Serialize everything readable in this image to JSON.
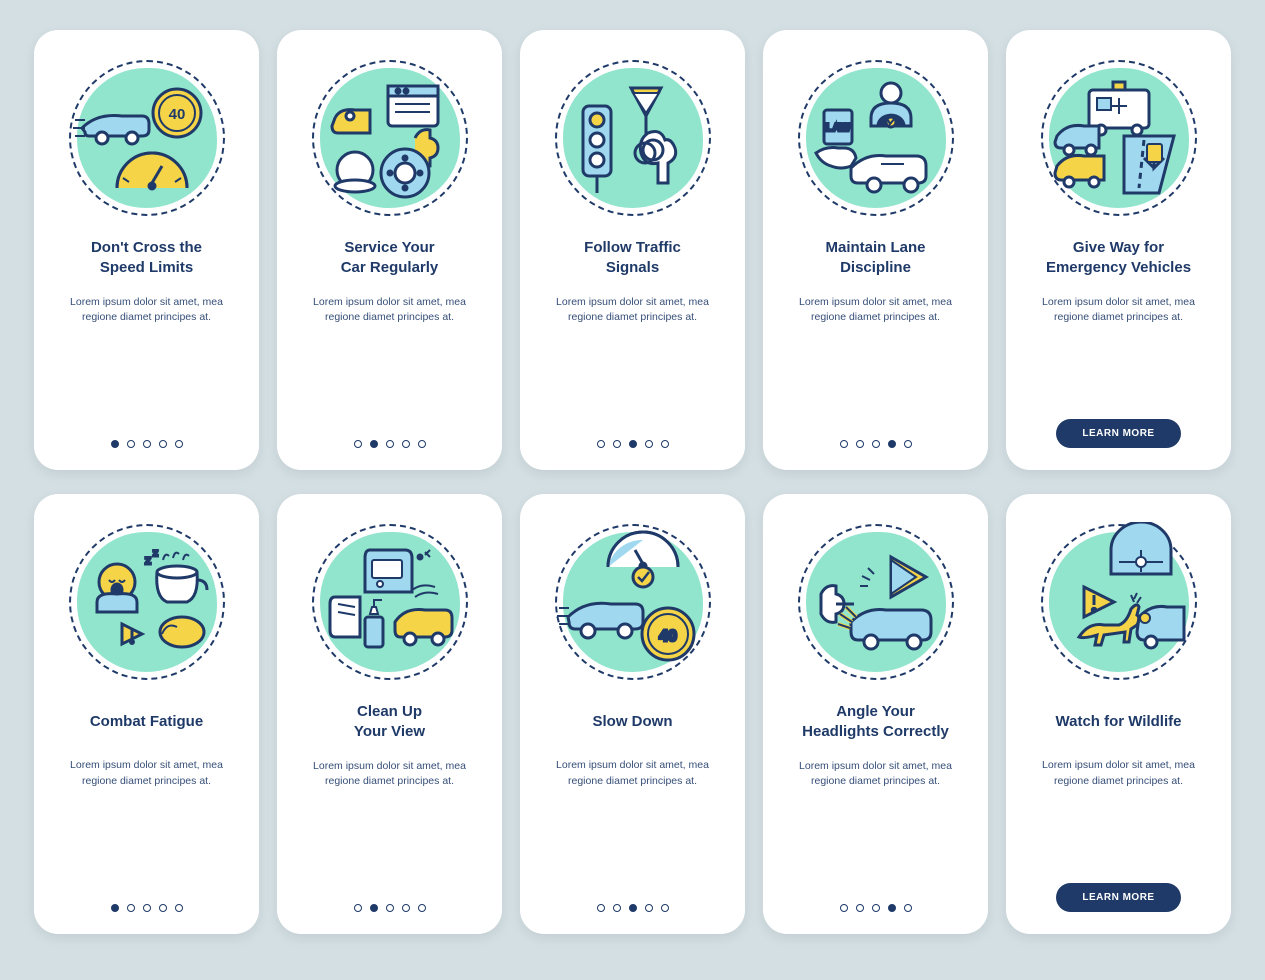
{
  "colors": {
    "navy": "#1f3a68",
    "mint": "#7fe0c4",
    "yellow": "#f5d547",
    "lightblue": "#a0d8ef",
    "bg": "#d3dfe3"
  },
  "lorem": "Lorem ipsum dolor sit amet, mea regione diamet principes at.",
  "learn_more": "LEARN MORE",
  "cards": [
    {
      "id": "speed-limits",
      "title": "Don't Cross the\nSpeed Limits",
      "icon": "speed-limit-icon",
      "active_dot": 0,
      "has_button": false
    },
    {
      "id": "service-car",
      "title": "Service Your\nCar Regularly",
      "icon": "service-car-icon",
      "active_dot": 1,
      "has_button": false
    },
    {
      "id": "traffic-signals",
      "title": "Follow Traffic\nSignals",
      "icon": "traffic-signal-icon",
      "active_dot": 2,
      "has_button": false
    },
    {
      "id": "lane-discipline",
      "title": "Maintain Lane\nDiscipline",
      "icon": "lane-discipline-icon",
      "active_dot": 3,
      "has_button": false
    },
    {
      "id": "emergency-vehicles",
      "title": "Give Way for\nEmergency Vehicles",
      "icon": "emergency-icon",
      "active_dot": 4,
      "has_button": true
    },
    {
      "id": "combat-fatigue",
      "title": "Combat Fatigue",
      "icon": "fatigue-icon",
      "active_dot": 0,
      "has_button": false
    },
    {
      "id": "clean-view",
      "title": "Clean Up\nYour View",
      "icon": "clean-view-icon",
      "active_dot": 1,
      "has_button": false
    },
    {
      "id": "slow-down",
      "title": "Slow Down",
      "icon": "slow-down-icon",
      "active_dot": 2,
      "has_button": false
    },
    {
      "id": "headlights",
      "title": "Angle Your\nHeadlights Correctly",
      "icon": "headlights-icon",
      "active_dot": 3,
      "has_button": false
    },
    {
      "id": "wildlife",
      "title": "Watch for Wildlife",
      "icon": "wildlife-icon",
      "active_dot": 4,
      "has_button": true
    }
  ]
}
